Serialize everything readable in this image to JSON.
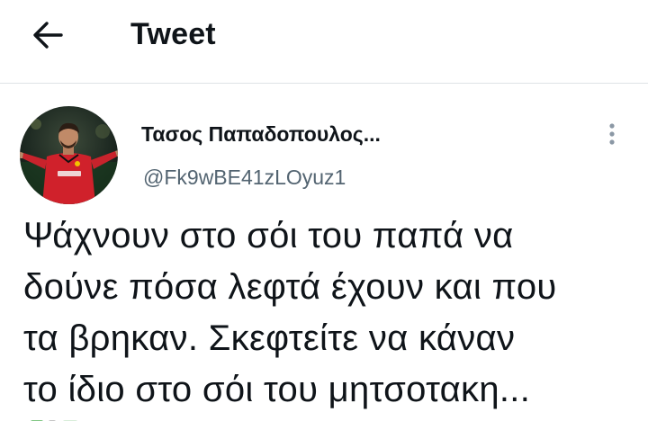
{
  "header": {
    "back_icon": "arrow-left-icon",
    "title": "Tweet"
  },
  "author": {
    "avatar_icon": "user-avatar-football-player",
    "display_name": "Τασος Παπαδοπουλος...",
    "handle": "@Fk9wBE41zLOyuz1"
  },
  "more_icon": "more-vertical-icon",
  "tweet": {
    "lines": [
      "Ψάχνουν στο σόι του παπά να",
      "δούνε πόσα λεφτά έχουν και που",
      "τα βρηκαν. Σκεφτείτε να κάναν",
      "το ίδιο στο σόι του μητσοτακη..."
    ]
  },
  "colors": {
    "text_primary": "#0f1419",
    "text_secondary": "#536471",
    "divider": "#dfe3e6",
    "background": "#ffffff"
  }
}
